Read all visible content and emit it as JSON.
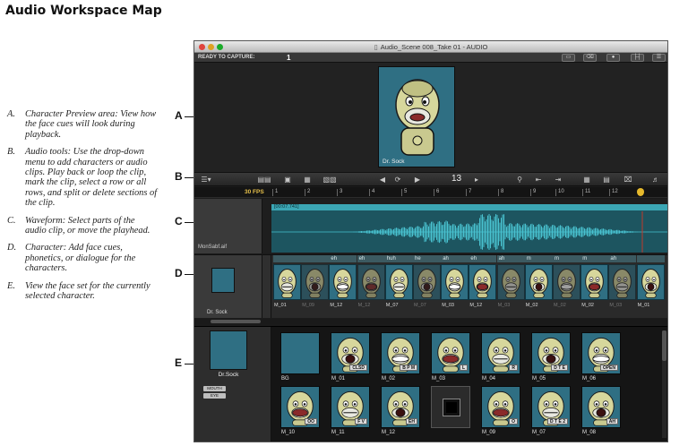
{
  "page": {
    "title": "Audio Workspace Map"
  },
  "legend": [
    {
      "key": "A.",
      "text": "Character Preview area: View how the face cues will look during playback."
    },
    {
      "key": "B.",
      "text": "Audio tools: Use the drop-down menu to add characters or audio clips. Play back or loop the clip, mark the clip, select a row or all rows, and split or delete sections of the clip."
    },
    {
      "key": "C.",
      "text": "Waveform: Select parts of the audio clip, or move the playhead."
    },
    {
      "key": "D.",
      "text": "Character: Add face cues, phonetics, or dialogue for the characters."
    },
    {
      "key": "E.",
      "text": "View the face set for the currently selected character."
    }
  ],
  "callouts": {
    "a": "A",
    "b": "B",
    "c": "C",
    "d": "D",
    "e": "E"
  },
  "window": {
    "title": "Audio_Scene 008_Take 01 - AUDIO",
    "status_label": "READY TO CAPTURE:",
    "status_count": "1"
  },
  "preview": {
    "caption": "Dr. Sock"
  },
  "toolbar": {
    "frame_number": "13"
  },
  "ruler": {
    "fps": "30 FPS",
    "ticks": [
      "1",
      "2",
      "3",
      "4",
      "5",
      "6",
      "7",
      "8",
      "9",
      "10",
      "11",
      "12"
    ]
  },
  "waveform": {
    "clip_time": "[00:07.741]",
    "filename": "MonSabf.aif"
  },
  "character_track": {
    "name": "Dr. Sock",
    "cues": [
      {
        "label": "",
        "name": "M_01",
        "dim": false
      },
      {
        "label": "",
        "name": "M_09",
        "dim": true
      },
      {
        "label": "eh",
        "name": "M_12",
        "dim": false
      },
      {
        "label": "eh",
        "name": "M_12",
        "dim": true
      },
      {
        "label": "huh",
        "name": "M_07",
        "dim": false
      },
      {
        "label": "he",
        "name": "M_07",
        "dim": true
      },
      {
        "label": "ah",
        "name": "M_03",
        "dim": false
      },
      {
        "label": "eh",
        "name": "M_12",
        "dim": false
      },
      {
        "label": "ah",
        "name": "M_03",
        "dim": true
      },
      {
        "label": "m",
        "name": "M_02",
        "dim": false
      },
      {
        "label": "m",
        "name": "M_02",
        "dim": true
      },
      {
        "label": "m",
        "name": "M_02",
        "dim": false
      },
      {
        "label": "ah",
        "name": "M_03",
        "dim": true
      },
      {
        "label": "",
        "name": "M_01",
        "dim": false
      }
    ]
  },
  "faceset": {
    "character": "Dr.Sock",
    "buttons": [
      "MOUTH",
      "EYE"
    ],
    "tiles": [
      {
        "label": "BG",
        "tag": "",
        "type": "empty"
      },
      {
        "label": "M_01",
        "tag": "CLSD",
        "type": "face"
      },
      {
        "label": "M_02",
        "tag": "B P M",
        "type": "face"
      },
      {
        "label": "M_03",
        "tag": "L",
        "type": "face"
      },
      {
        "label": "M_04",
        "tag": "R",
        "type": "face"
      },
      {
        "label": "M_05",
        "tag": "D T E",
        "type": "face"
      },
      {
        "label": "M_06",
        "tag": "OPEN",
        "type": "face"
      },
      {
        "label": "M_10",
        "tag": "OO",
        "type": "face"
      },
      {
        "label": "M_11",
        "tag": "F V",
        "type": "face"
      },
      {
        "label": "M_12",
        "tag": "EH",
        "type": "face"
      },
      {
        "label": "",
        "tag": "",
        "type": "blank"
      },
      {
        "label": "M_09",
        "tag": "O",
        "type": "face"
      },
      {
        "label": "M_07",
        "tag": "D T E 2",
        "type": "face"
      },
      {
        "label": "M_08",
        "tag": "AH",
        "type": "face"
      }
    ]
  },
  "colors": {
    "accent_teal": "#2f6f83",
    "waveform": "#3ba6b4",
    "playhead": "#e6b92c"
  }
}
